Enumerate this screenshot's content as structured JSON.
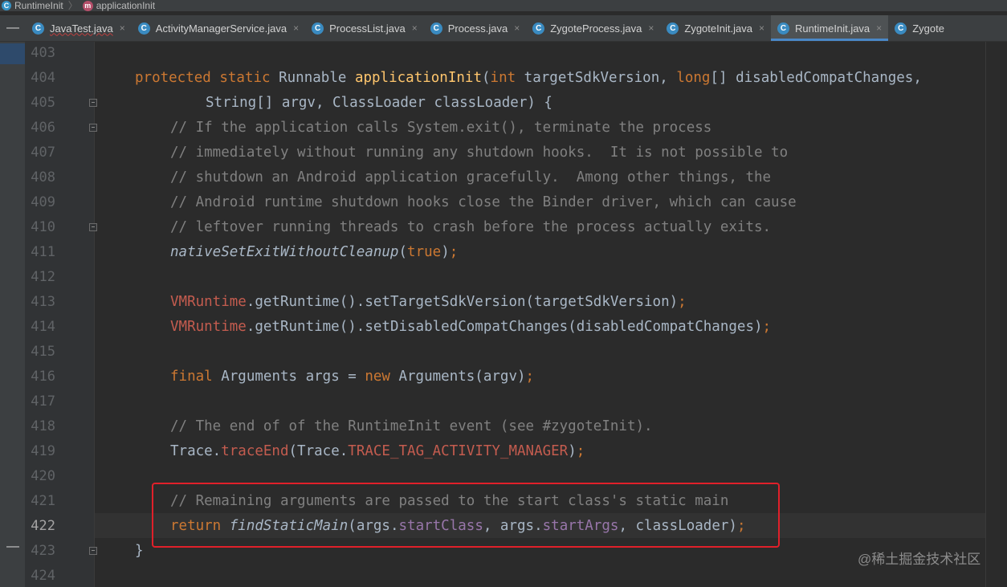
{
  "breadcrumb": {
    "class_icon": "C",
    "class_name": "RuntimeInit",
    "method_icon": "m",
    "method_name": "applicationInit"
  },
  "tabs": [
    {
      "label": "JavaTest.java",
      "icon": "C",
      "spell_error": true,
      "active": false
    },
    {
      "label": "ActivityManagerService.java",
      "icon": "C",
      "active": false
    },
    {
      "label": "ProcessList.java",
      "icon": "C",
      "active": false
    },
    {
      "label": "Process.java",
      "icon": "C",
      "active": false
    },
    {
      "label": "ZygoteProcess.java",
      "icon": "C",
      "active": false
    },
    {
      "label": "ZygoteInit.java",
      "icon": "C",
      "active": false
    },
    {
      "label": "RuntimeInit.java",
      "icon": "C",
      "active": true
    },
    {
      "label": "Zygote",
      "icon": "C",
      "active": false
    }
  ],
  "close_glyph": "×",
  "collapse_glyph": "—",
  "line_numbers": [
    "403",
    "404",
    "405",
    "406",
    "407",
    "408",
    "409",
    "410",
    "411",
    "412",
    "413",
    "414",
    "415",
    "416",
    "417",
    "418",
    "419",
    "420",
    "421",
    "422",
    "423",
    "424"
  ],
  "current_line": "422",
  "code": {
    "l404": {
      "kw1": "protected static",
      "t1": " Runnable ",
      "fn": "applicationInit",
      "t2": "(",
      "kw2": "int",
      "t3": " targetSdkVersion, ",
      "kw3": "long",
      "t4": "[] disabledCompatChanges,"
    },
    "l405": "String[] argv, ClassLoader classLoader) {",
    "l406": "// If the application calls System.exit(), terminate the process",
    "l407": "// immediately without running any shutdown hooks.  It is not possible to",
    "l408": "// shutdown an Android application gracefully.  Among other things, the",
    "l409": "// Android runtime shutdown hooks close the Binder driver, which can cause",
    "l410": "// leftover running threads to crash before the process actually exits.",
    "l411": {
      "fn": "nativeSetExitWithoutCleanup",
      "t1": "(",
      "kw": "true",
      "t2": ")",
      "semi": ";"
    },
    "l413": {
      "cls": "VMRuntime",
      "t1": ".getRuntime().setTargetSdkVersion(targetSdkVersion)",
      "semi": ";"
    },
    "l414": {
      "cls": "VMRuntime",
      "t1": ".getRuntime().setDisabledCompatChanges(disabledCompatChanges)",
      "semi": ";"
    },
    "l416": {
      "kw1": "final",
      "t1": " Arguments args = ",
      "kw2": "new",
      "t2": " Arguments(argv)",
      "semi": ";"
    },
    "l418": "// The end of of the RuntimeInit event (see #zygoteInit).",
    "l419": {
      "t1": "Trace.",
      "fn": "traceEnd",
      "t2": "(Trace.",
      "const": "TRACE_TAG_ACTIVITY_MANAGER",
      "t3": ")",
      "semi": ";"
    },
    "l421": "// Remaining arguments are passed to the start class's static main",
    "l422": {
      "kw": "return",
      "fn": "findStaticMain",
      "t1": "(args.",
      "f1": "startClass",
      "t2": ", args.",
      "f2": "startArgs",
      "t3": ", classLoader)",
      "semi": ";"
    },
    "l423": "}"
  },
  "watermark": "@稀土掘金技术社区",
  "colors": {
    "keyword": "#cc7832",
    "method": "#ffc66d",
    "comment": "#808080",
    "field": "#9876aa",
    "highlight_border": "#e0202a"
  }
}
